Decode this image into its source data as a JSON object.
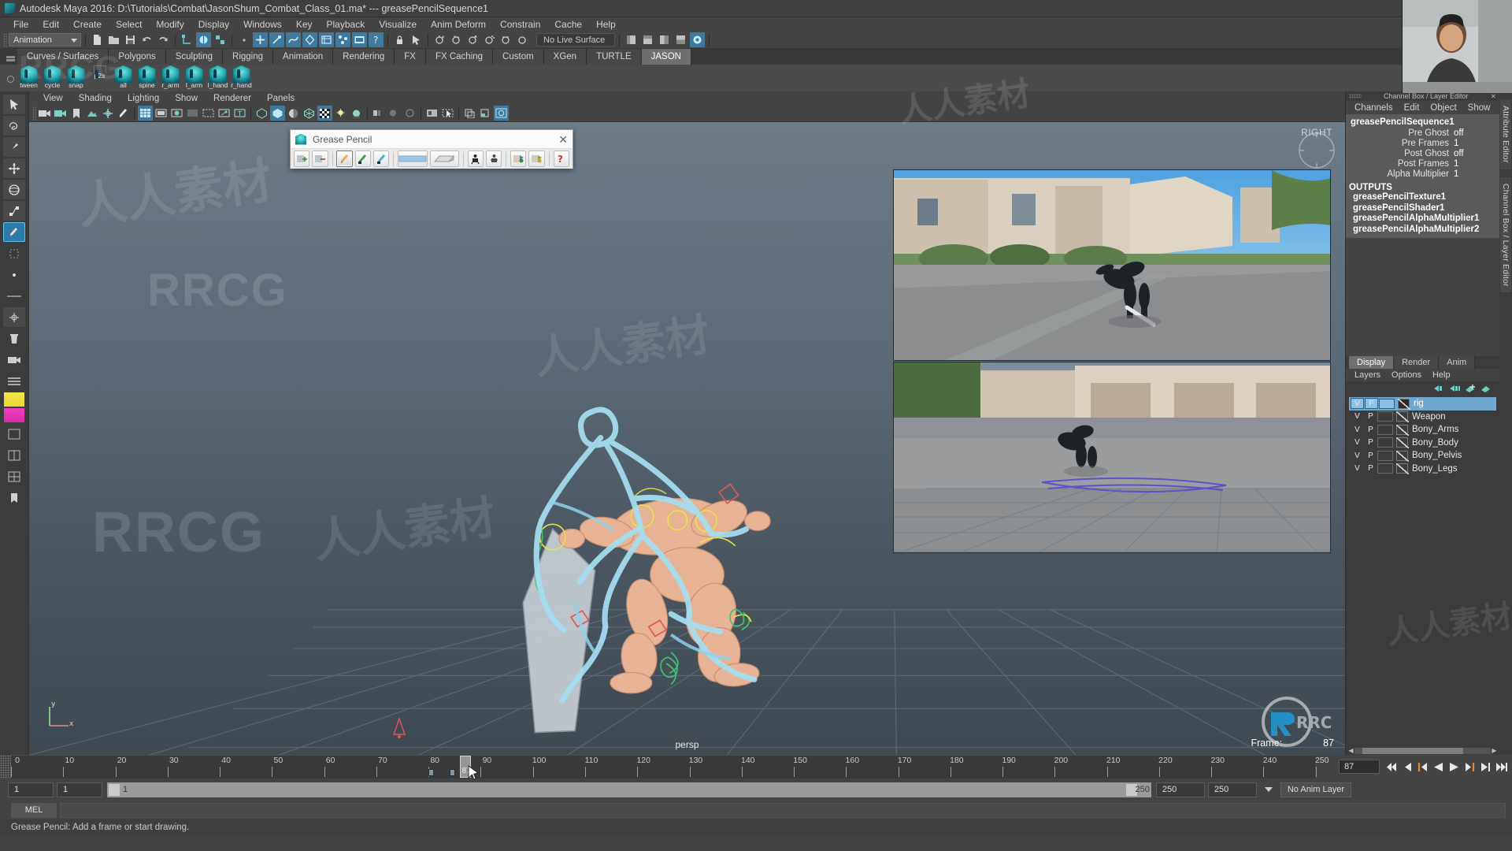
{
  "window": {
    "title": "Autodesk Maya 2016: D:\\Tutorials\\Combat\\JasonShum_Combat_Class_01.ma*   ---   greasePencilSequence1",
    "logo_name": "maya-logo"
  },
  "menubar": {
    "items": [
      "File",
      "Edit",
      "Create",
      "Select",
      "Modify",
      "Display",
      "Windows",
      "Key",
      "Playback",
      "Visualize",
      "Anim Deform",
      "Constrain",
      "Cache",
      "Help"
    ]
  },
  "statusline": {
    "menu_set": "Animation",
    "no_live_surface": "No Live Surface"
  },
  "shelf": {
    "tabs": [
      "Curves / Surfaces",
      "Polygons",
      "Sculpting",
      "Rigging",
      "Animation",
      "Rendering",
      "FX",
      "FX Caching",
      "Custom",
      "XGen",
      "TURTLE",
      "JASON"
    ],
    "active_tab": "JASON",
    "buttons": [
      {
        "label": "tween"
      },
      {
        "label": "cycle"
      },
      {
        "label": "snap"
      },
      {
        "label": "p2s"
      },
      {
        "label": "all"
      },
      {
        "label": "spine"
      },
      {
        "label": "r_arm"
      },
      {
        "label": "l_arm"
      },
      {
        "label": "l_hand"
      },
      {
        "label": "r_hand"
      }
    ]
  },
  "panel": {
    "menus": [
      "View",
      "Shading",
      "Lighting",
      "Show",
      "Renderer",
      "Panels"
    ],
    "view_label": "persp",
    "right_view_label": "RIGHT",
    "frame_label": "Frame:",
    "frame_value": "87",
    "axis_y": "y",
    "axis_x": "x"
  },
  "grease_pencil_dialog": {
    "title": "Grease Pencil",
    "close_label": "✕",
    "tools": [
      {
        "name": "add-frame-icon"
      },
      {
        "name": "remove-frame-icon"
      },
      {
        "name": "pencil-tool-icon",
        "active": true
      },
      {
        "name": "marker-tool-icon"
      },
      {
        "name": "soft-pencil-icon"
      },
      {
        "name": "eraser-bar-icon"
      },
      {
        "name": "eraser-block-icon"
      },
      {
        "name": "ghost-before-icon"
      },
      {
        "name": "ghost-after-icon"
      },
      {
        "name": "blank-frame-icon"
      },
      {
        "name": "duplicate-frame-icon"
      },
      {
        "name": "help-icon"
      }
    ]
  },
  "channel_box": {
    "dock_title": "Channel Box / Layer Editor",
    "menus": [
      "Channels",
      "Edit",
      "Object",
      "Show"
    ],
    "node_name": "greasePencilSequence1",
    "attributes": [
      {
        "name": "Pre Ghost",
        "value": "off"
      },
      {
        "name": "Pre Frames",
        "value": "1"
      },
      {
        "name": "Post Ghost",
        "value": "off"
      },
      {
        "name": "Post Frames",
        "value": "1"
      },
      {
        "name": "Alpha Multiplier",
        "value": "1"
      }
    ],
    "outputs_header": "OUTPUTS",
    "outputs": [
      "greasePencilTexture1",
      "greasePencilShader1",
      "greasePencilAlphaMultiplier1",
      "greasePencilAlphaMultiplier2"
    ]
  },
  "layer_editor": {
    "tabs": [
      "Display",
      "Render",
      "Anim"
    ],
    "active_tab": "Display",
    "menus": [
      "Layers",
      "Options",
      "Help"
    ],
    "columns": {
      "visibility": "V",
      "playback": "P"
    },
    "layers": [
      {
        "name": "rig",
        "v": "V",
        "p": "P",
        "selected": true
      },
      {
        "name": "Weapon",
        "v": "V",
        "p": "P",
        "selected": false
      },
      {
        "name": "Bony_Arms",
        "v": "V",
        "p": "P",
        "selected": false
      },
      {
        "name": "Bony_Body",
        "v": "V",
        "p": "P",
        "selected": false
      },
      {
        "name": "Bony_Pelvis",
        "v": "V",
        "p": "P",
        "selected": false
      },
      {
        "name": "Bony_Legs",
        "v": "V",
        "p": "P",
        "selected": false
      }
    ]
  },
  "side_tabs": [
    "Attribute Editor",
    "Channel Box / Layer Editor"
  ],
  "timeline": {
    "ticks": [
      0,
      10,
      20,
      30,
      40,
      50,
      60,
      70,
      80,
      90,
      100,
      110,
      120,
      130,
      140,
      150,
      160,
      170,
      180,
      190,
      200,
      210,
      220,
      230,
      240,
      250
    ],
    "start": 0,
    "end": 252,
    "current_frame": "87",
    "current_frame_field": "87",
    "key_frames": [
      80,
      84
    ],
    "playback_buttons": [
      {
        "name": "go-to-start-button"
      },
      {
        "name": "step-back-frame-button"
      },
      {
        "name": "step-back-key-button"
      },
      {
        "name": "play-backwards-button"
      },
      {
        "name": "play-forwards-button"
      },
      {
        "name": "step-forward-key-button"
      },
      {
        "name": "step-forward-frame-button"
      },
      {
        "name": "go-to-end-button"
      }
    ]
  },
  "range_slider": {
    "anim_start": "1",
    "range_start": "1",
    "bar_left_value": "1",
    "bar_right_value": "250",
    "range_end": "250",
    "anim_end": "250",
    "anim_layer": "No Anim Layer"
  },
  "command_line": {
    "tab_label": "MEL",
    "input_value": ""
  },
  "help_line": {
    "text": "Grease Pencil: Add a frame or start drawing."
  },
  "watermarks": {
    "cn_text": "人人素材",
    "rrcg_text": "RRCG"
  },
  "colors": {
    "accent_blue": "#3f7a9e",
    "shelf_active": "#6f6f6f",
    "layer_selected": "#6fa8d0",
    "channelbox_bg": "#5a5a5a",
    "viewport_top": "#6e7c88",
    "grease_pencil_bg": "#e9e9e9"
  }
}
